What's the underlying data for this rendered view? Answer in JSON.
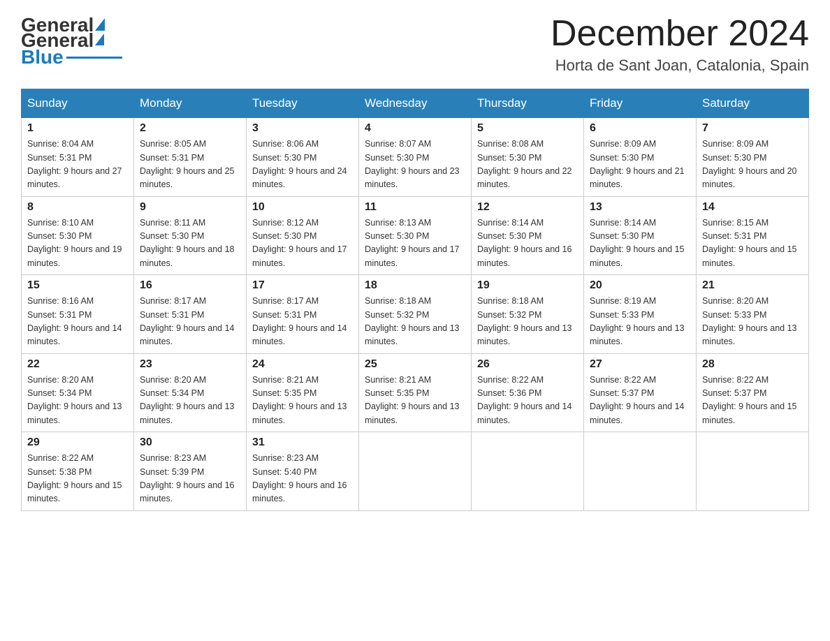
{
  "header": {
    "logo": {
      "general": "General",
      "blue": "Blue"
    },
    "title": "December 2024",
    "location": "Horta de Sant Joan, Catalonia, Spain"
  },
  "weekdays": [
    "Sunday",
    "Monday",
    "Tuesday",
    "Wednesday",
    "Thursday",
    "Friday",
    "Saturday"
  ],
  "weeks": [
    [
      {
        "day": 1,
        "sunrise": "8:04 AM",
        "sunset": "5:31 PM",
        "daylight": "9 hours and 27 minutes"
      },
      {
        "day": 2,
        "sunrise": "8:05 AM",
        "sunset": "5:31 PM",
        "daylight": "9 hours and 25 minutes"
      },
      {
        "day": 3,
        "sunrise": "8:06 AM",
        "sunset": "5:30 PM",
        "daylight": "9 hours and 24 minutes"
      },
      {
        "day": 4,
        "sunrise": "8:07 AM",
        "sunset": "5:30 PM",
        "daylight": "9 hours and 23 minutes"
      },
      {
        "day": 5,
        "sunrise": "8:08 AM",
        "sunset": "5:30 PM",
        "daylight": "9 hours and 22 minutes"
      },
      {
        "day": 6,
        "sunrise": "8:09 AM",
        "sunset": "5:30 PM",
        "daylight": "9 hours and 21 minutes"
      },
      {
        "day": 7,
        "sunrise": "8:09 AM",
        "sunset": "5:30 PM",
        "daylight": "9 hours and 20 minutes"
      }
    ],
    [
      {
        "day": 8,
        "sunrise": "8:10 AM",
        "sunset": "5:30 PM",
        "daylight": "9 hours and 19 minutes"
      },
      {
        "day": 9,
        "sunrise": "8:11 AM",
        "sunset": "5:30 PM",
        "daylight": "9 hours and 18 minutes"
      },
      {
        "day": 10,
        "sunrise": "8:12 AM",
        "sunset": "5:30 PM",
        "daylight": "9 hours and 17 minutes"
      },
      {
        "day": 11,
        "sunrise": "8:13 AM",
        "sunset": "5:30 PM",
        "daylight": "9 hours and 17 minutes"
      },
      {
        "day": 12,
        "sunrise": "8:14 AM",
        "sunset": "5:30 PM",
        "daylight": "9 hours and 16 minutes"
      },
      {
        "day": 13,
        "sunrise": "8:14 AM",
        "sunset": "5:30 PM",
        "daylight": "9 hours and 15 minutes"
      },
      {
        "day": 14,
        "sunrise": "8:15 AM",
        "sunset": "5:31 PM",
        "daylight": "9 hours and 15 minutes"
      }
    ],
    [
      {
        "day": 15,
        "sunrise": "8:16 AM",
        "sunset": "5:31 PM",
        "daylight": "9 hours and 14 minutes"
      },
      {
        "day": 16,
        "sunrise": "8:17 AM",
        "sunset": "5:31 PM",
        "daylight": "9 hours and 14 minutes"
      },
      {
        "day": 17,
        "sunrise": "8:17 AM",
        "sunset": "5:31 PM",
        "daylight": "9 hours and 14 minutes"
      },
      {
        "day": 18,
        "sunrise": "8:18 AM",
        "sunset": "5:32 PM",
        "daylight": "9 hours and 13 minutes"
      },
      {
        "day": 19,
        "sunrise": "8:18 AM",
        "sunset": "5:32 PM",
        "daylight": "9 hours and 13 minutes"
      },
      {
        "day": 20,
        "sunrise": "8:19 AM",
        "sunset": "5:33 PM",
        "daylight": "9 hours and 13 minutes"
      },
      {
        "day": 21,
        "sunrise": "8:20 AM",
        "sunset": "5:33 PM",
        "daylight": "9 hours and 13 minutes"
      }
    ],
    [
      {
        "day": 22,
        "sunrise": "8:20 AM",
        "sunset": "5:34 PM",
        "daylight": "9 hours and 13 minutes"
      },
      {
        "day": 23,
        "sunrise": "8:20 AM",
        "sunset": "5:34 PM",
        "daylight": "9 hours and 13 minutes"
      },
      {
        "day": 24,
        "sunrise": "8:21 AM",
        "sunset": "5:35 PM",
        "daylight": "9 hours and 13 minutes"
      },
      {
        "day": 25,
        "sunrise": "8:21 AM",
        "sunset": "5:35 PM",
        "daylight": "9 hours and 13 minutes"
      },
      {
        "day": 26,
        "sunrise": "8:22 AM",
        "sunset": "5:36 PM",
        "daylight": "9 hours and 14 minutes"
      },
      {
        "day": 27,
        "sunrise": "8:22 AM",
        "sunset": "5:37 PM",
        "daylight": "9 hours and 14 minutes"
      },
      {
        "day": 28,
        "sunrise": "8:22 AM",
        "sunset": "5:37 PM",
        "daylight": "9 hours and 15 minutes"
      }
    ],
    [
      {
        "day": 29,
        "sunrise": "8:22 AM",
        "sunset": "5:38 PM",
        "daylight": "9 hours and 15 minutes"
      },
      {
        "day": 30,
        "sunrise": "8:23 AM",
        "sunset": "5:39 PM",
        "daylight": "9 hours and 16 minutes"
      },
      {
        "day": 31,
        "sunrise": "8:23 AM",
        "sunset": "5:40 PM",
        "daylight": "9 hours and 16 minutes"
      },
      null,
      null,
      null,
      null
    ]
  ]
}
